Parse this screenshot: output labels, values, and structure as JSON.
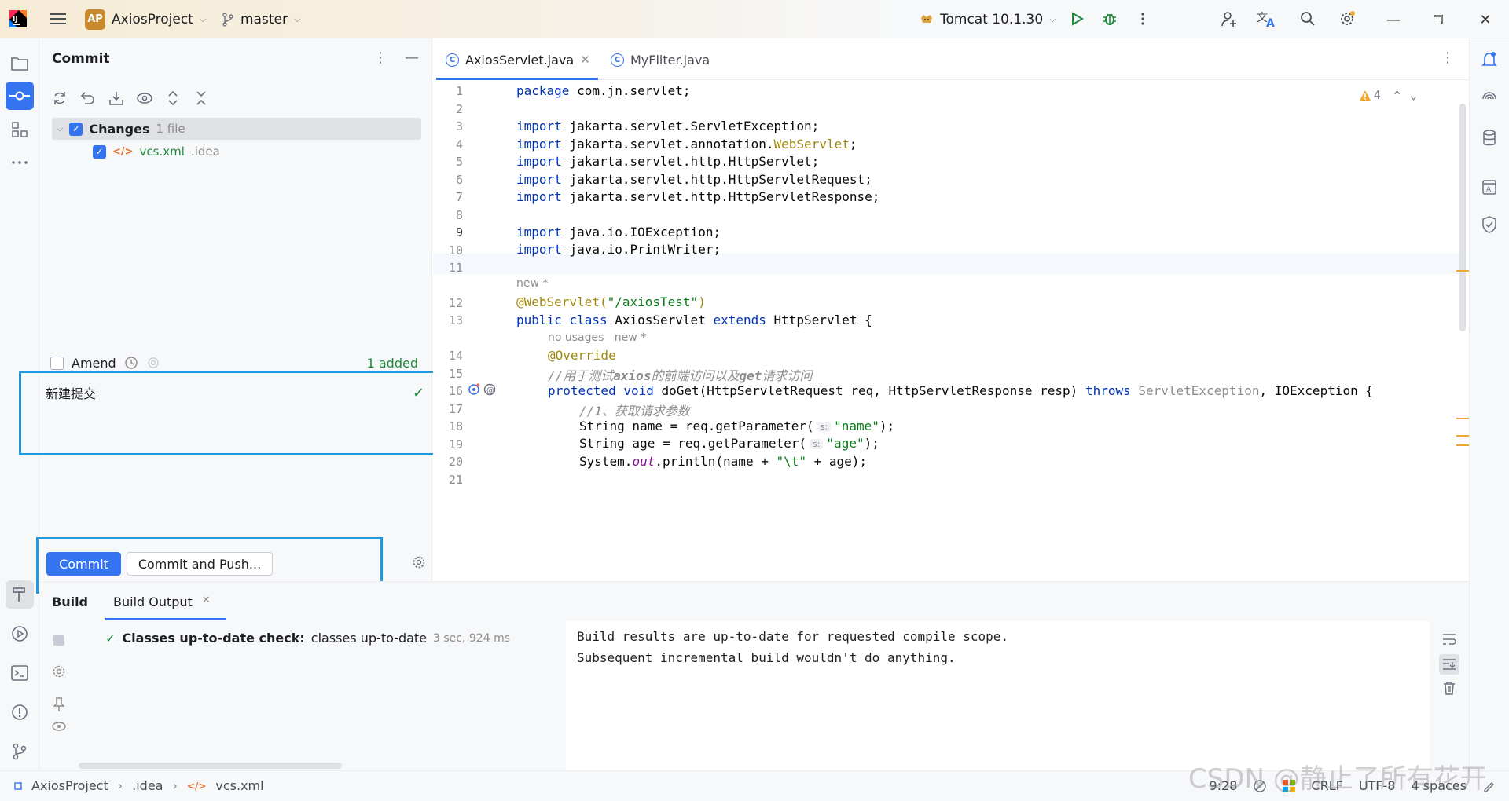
{
  "titlebar": {
    "project_badge": "AP",
    "project_name": "AxiosProject",
    "branch": "master",
    "run_config": "Tomcat 10.1.30"
  },
  "commit_panel": {
    "title": "Commit",
    "changes_label": "Changes",
    "changes_count": "1 file",
    "file_name": "vcs.xml",
    "file_dir": ".idea",
    "amend_label": "Amend",
    "added_label": "1 added",
    "message": "新建提交",
    "commit_button": "Commit",
    "commit_push_button": "Commit and Push..."
  },
  "editor": {
    "tabs": [
      {
        "label": "AxiosServlet.java",
        "active": true
      },
      {
        "label": "MyFliter.java",
        "active": false
      }
    ],
    "warnings_count": "4",
    "hint_new": "new *",
    "hint_no_usages": "no usages",
    "line_numbers": [
      "1",
      "2",
      "3",
      "4",
      "5",
      "6",
      "7",
      "8",
      "9",
      "10",
      "11",
      "12",
      "13",
      "14",
      "15",
      "16",
      "17",
      "18",
      "19",
      "20",
      "21"
    ],
    "lines": {
      "l1_pkg": "package",
      "l1_rest": " com.jn.servlet;",
      "import_kw": "import",
      "l3": " jakarta.servlet.ServletException;",
      "l4a": " jakarta.servlet.annotation.",
      "l4b": "WebServlet",
      "l4c": ";",
      "l5": " jakarta.servlet.http.HttpServlet;",
      "l6": " jakarta.servlet.http.HttpServletRequest;",
      "l7": " jakarta.servlet.http.HttpServletResponse;",
      "l9": " java.io.IOException;",
      "l10": " java.io.PrintWriter;",
      "l12a": "@WebServlet(",
      "l12b": "\"/axiosTest\"",
      "l12c": ")",
      "l13a": "public class",
      "l13b": " AxiosServlet ",
      "l13c": "extends",
      "l13d": " HttpServlet {",
      "l14": "@Override",
      "l15a": "//用于测试",
      "l15b": "axios",
      "l15c": "的前端访问以及",
      "l15d": "get",
      "l15e": "请求访问",
      "l16a": "protected void",
      "l16b": " doGet(HttpServletRequest req, HttpServletResponse resp) ",
      "l16c": "throws",
      "l16d": " ServletException",
      "l16e": ", IOException {",
      "l17": "//1、获取请求参数",
      "l18a": "String name = req.getParameter(",
      "param_hint": "s:",
      "l18b": "\"name\"",
      "l18c": ");",
      "l19a": "String age = req.getParameter(",
      "l19b": "\"age\"",
      "l19c": ");",
      "l20a": "System.",
      "l20b": "out",
      "l20c": ".println(name + ",
      "l20d": "\"\\t\"",
      "l20e": " + age);"
    }
  },
  "build": {
    "title": "Build",
    "tab": "Build Output",
    "tree_label_bold": "Classes up-to-date check:",
    "tree_label": "classes up-to-date",
    "tree_time": "3 sec, 924 ms",
    "output": "Build results are up-to-date for requested compile scope.\nSubsequent incremental build wouldn't do anything."
  },
  "statusbar": {
    "crumbs": [
      "AxiosProject",
      ".idea",
      "vcs.xml"
    ],
    "position": "9:28",
    "line_sep": "CRLF",
    "encoding": "UTF-8",
    "indent": "4 spaces"
  },
  "watermark": "CSDN @静止了所有花开",
  "colors": {
    "accent": "#3574f0",
    "highlight_box": "#1e9ae0",
    "added": "#208a3c"
  }
}
